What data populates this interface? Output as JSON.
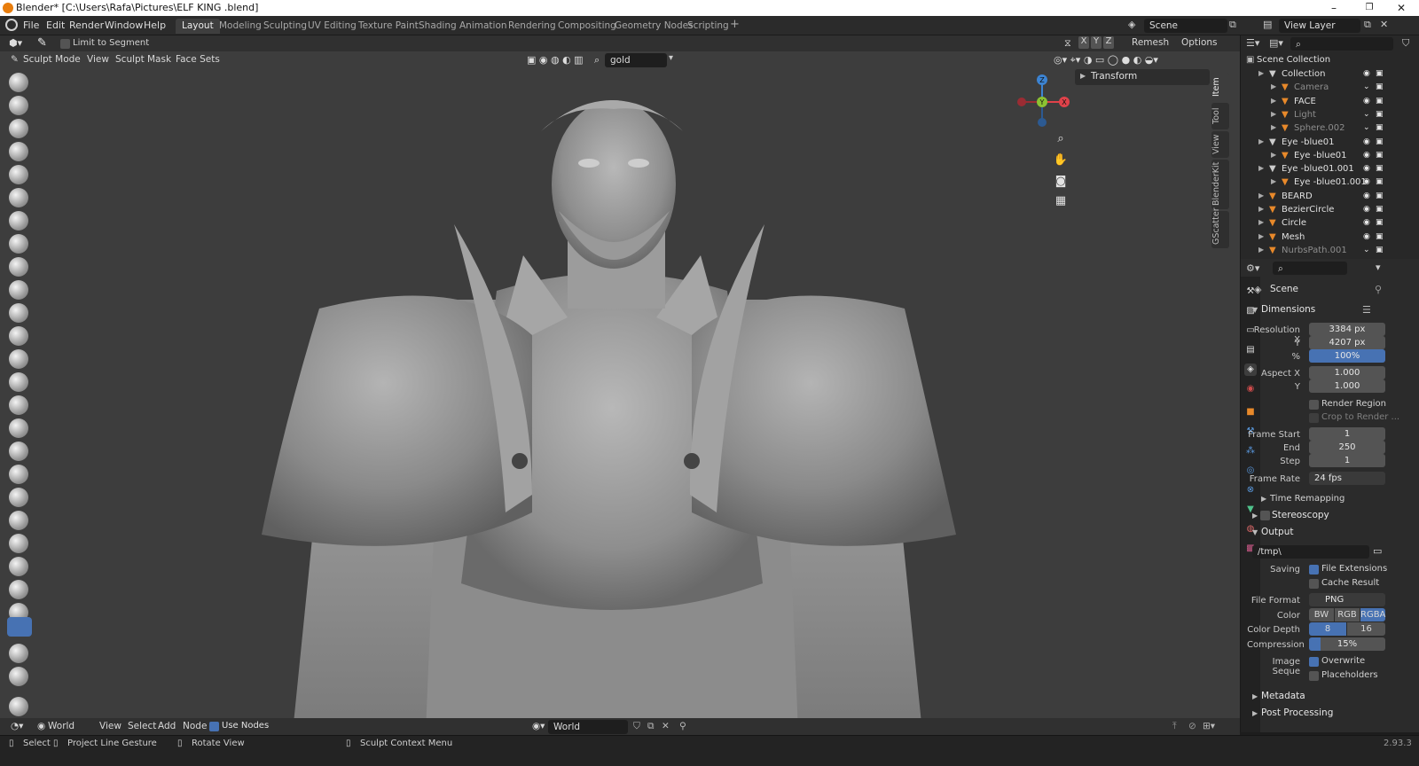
{
  "window": {
    "title": "Blender* [C:\\Users\\Rafa\\Pictures\\ELF KING .blend]",
    "minimize": "–",
    "maximize": "❐",
    "close": "✕"
  },
  "menu": [
    "File",
    "Edit",
    "Render",
    "Window",
    "Help"
  ],
  "workspaces": [
    {
      "label": "Layout",
      "active": true
    },
    {
      "label": "Modeling"
    },
    {
      "label": "Sculpting"
    },
    {
      "label": "UV Editing"
    },
    {
      "label": "Texture Paint"
    },
    {
      "label": "Shading"
    },
    {
      "label": "Animation"
    },
    {
      "label": "Rendering"
    },
    {
      "label": "Compositing"
    },
    {
      "label": "Geometry Nodes"
    },
    {
      "label": "Scripting"
    },
    {
      "label": "+"
    }
  ],
  "scene_field": "Scene",
  "view_layer_field": "View Layer",
  "tool_header": {
    "limit_to_segment": "Limit to Segment",
    "axes": [
      "X",
      "Y",
      "Z"
    ],
    "remesh": "Remesh",
    "options": "Options"
  },
  "viewport_header": {
    "mode": "Sculpt Mode",
    "menus": [
      "View",
      "Sculpt",
      "Mask",
      "Face Sets"
    ],
    "search_value": "gold"
  },
  "gizmo": {
    "z": "Z",
    "y": "Y",
    "x": "X"
  },
  "side_tabs": [
    "Item",
    "Tool",
    "View",
    "BlenderKit",
    "GScatter"
  ],
  "transform_panel": "Transform",
  "outliner": {
    "root": "Scene Collection",
    "rows": [
      {
        "name": "Collection",
        "indent": 1,
        "dim": false
      },
      {
        "name": "Camera",
        "indent": 2,
        "dim": true
      },
      {
        "name": "FACE",
        "indent": 2,
        "dim": false
      },
      {
        "name": "Light",
        "indent": 2,
        "dim": true
      },
      {
        "name": "Sphere.002",
        "indent": 2,
        "dim": true
      },
      {
        "name": "Eye -blue01",
        "indent": 1,
        "dim": false
      },
      {
        "name": "Eye -blue01",
        "indent": 2,
        "dim": false
      },
      {
        "name": "Eye -blue01.001",
        "indent": 1,
        "dim": false
      },
      {
        "name": "Eye -blue01.001",
        "indent": 2,
        "dim": false
      },
      {
        "name": "BEARD",
        "indent": 1,
        "dim": false
      },
      {
        "name": "BezierCircle",
        "indent": 1,
        "dim": false
      },
      {
        "name": "Circle",
        "indent": 1,
        "dim": false
      },
      {
        "name": "Mesh",
        "indent": 1,
        "dim": false
      },
      {
        "name": "NurbsPath.001",
        "indent": 1,
        "dim": true
      }
    ]
  },
  "properties": {
    "context": "Scene",
    "dimensions": {
      "title": "Dimensions",
      "res_x_label": "Resolution X",
      "res_x": "3384 px",
      "res_y_label": "Y",
      "res_y": "4207 px",
      "pct_label": "%",
      "pct": "100%",
      "aspect_x_label": "Aspect X",
      "aspect_x": "1.000",
      "aspect_y_label": "Y",
      "aspect_y": "1.000",
      "render_region": "Render Region",
      "crop": "Crop to Render ...",
      "frame_start_label": "Frame Start",
      "frame_start": "1",
      "end_label": "End",
      "end": "250",
      "step_label": "Step",
      "step": "1",
      "frame_rate_label": "Frame Rate",
      "frame_rate": "24 fps",
      "time_remapping": "Time Remapping"
    },
    "stereoscopy": "Stereoscopy",
    "output": {
      "title": "Output",
      "path": "/tmp\\",
      "saving_label": "Saving",
      "file_extensions": "File Extensions",
      "cache_result": "Cache Result",
      "file_format_label": "File Format",
      "file_format": "PNG",
      "color_label": "Color",
      "color_opts": [
        "BW",
        "RGB",
        "RGBA"
      ],
      "color_depth_label": "Color Depth",
      "depth_opts": [
        "8",
        "16"
      ],
      "compression_label": "Compression",
      "compression": "15%",
      "image_seq_label": "Image Seque",
      "overwrite": "Overwrite",
      "placeholders": "Placeholders"
    },
    "metadata": "Metadata",
    "post_processing": "Post Processing"
  },
  "bottom_header": {
    "world_type": "World",
    "menus": [
      "View",
      "Select",
      "Add",
      "Node"
    ],
    "use_nodes": "Use Nodes",
    "world_field": "World"
  },
  "status": {
    "select": "Select",
    "project": "Project Line Gesture",
    "rotate": "Rotate View",
    "context": "Sculpt Context Menu",
    "version": "2.93.3"
  },
  "colors": {
    "accent": "#4772b3",
    "x_axis": "#e0424a",
    "y_axis": "#8bc232",
    "z_axis": "#3c84d3",
    "brand": "#e87d0d"
  }
}
